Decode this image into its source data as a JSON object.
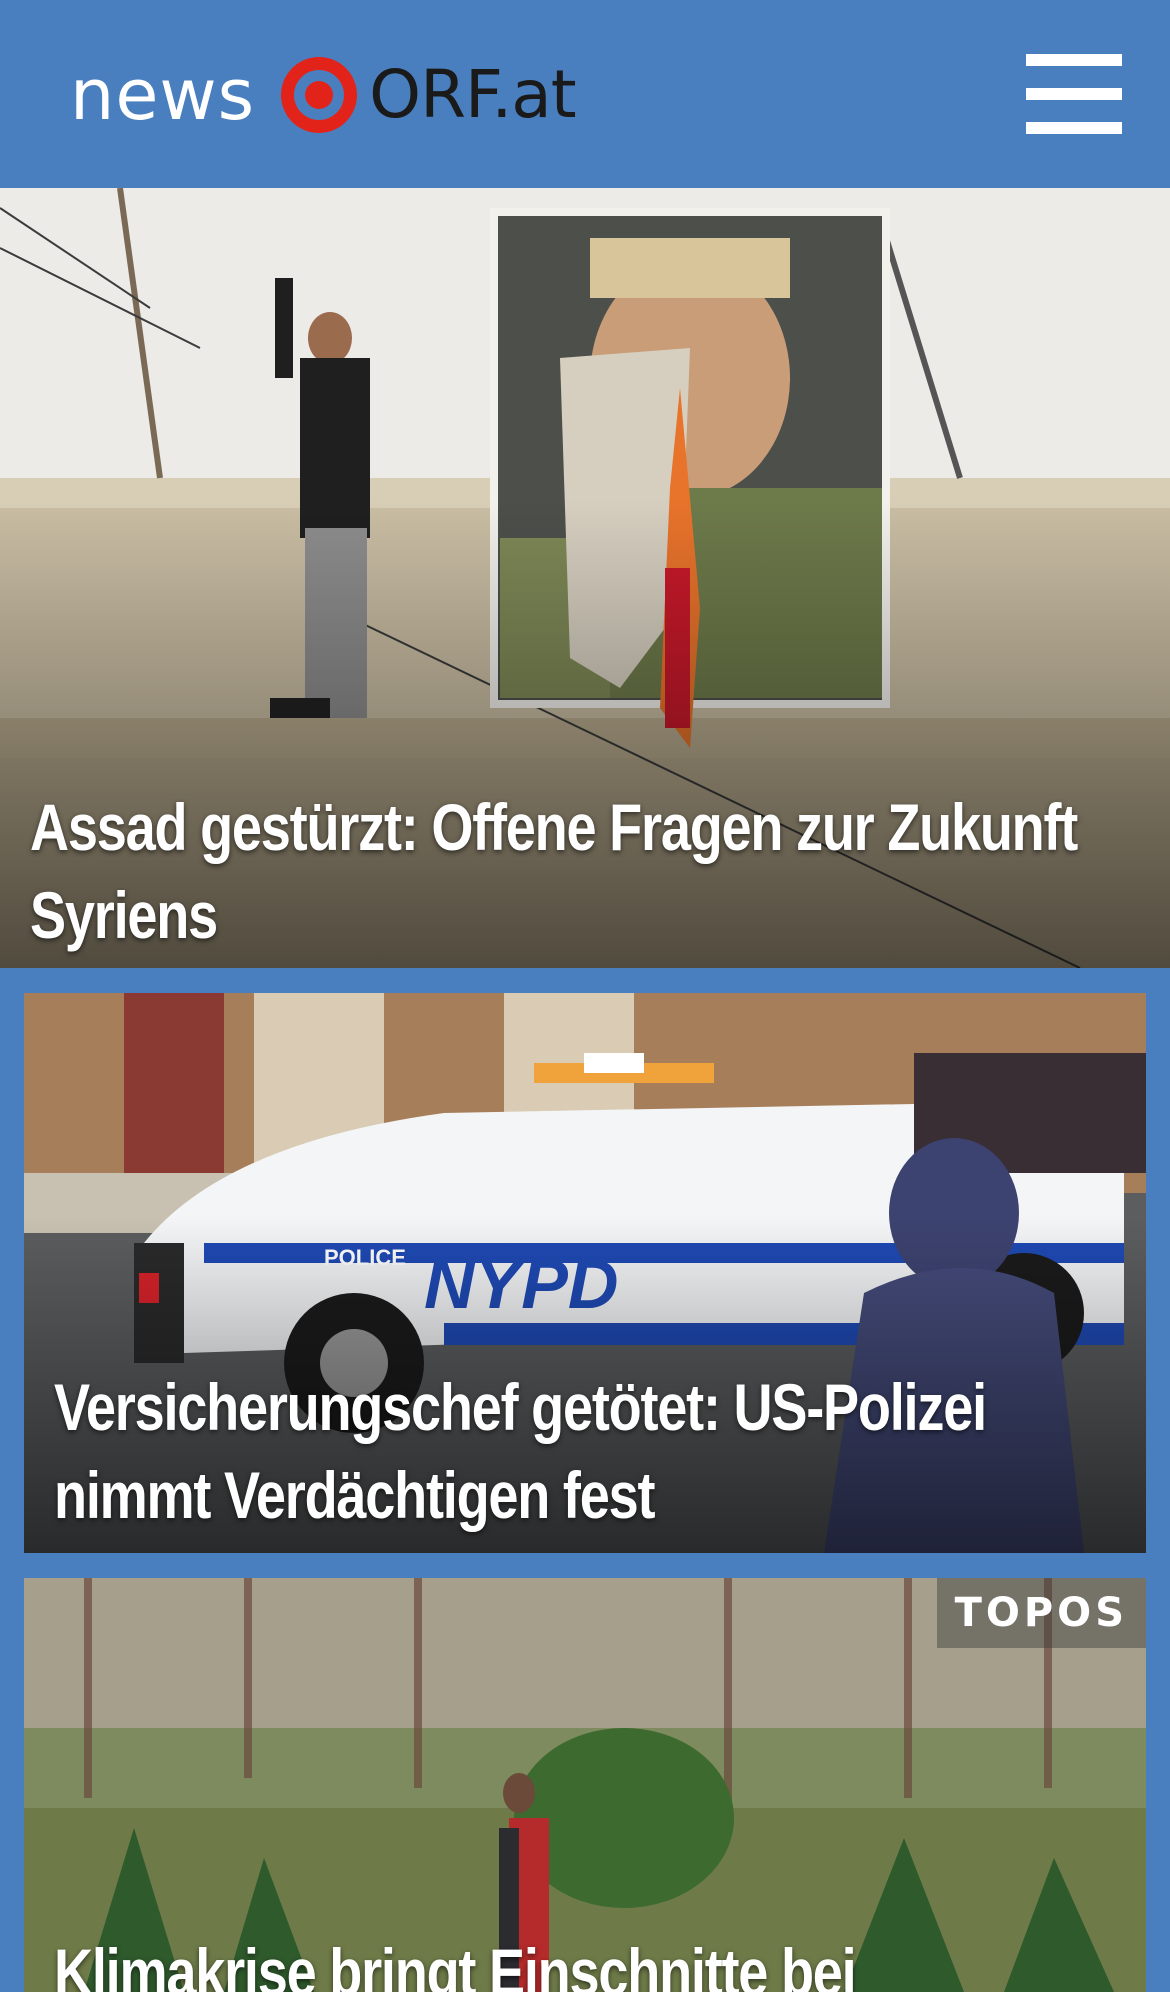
{
  "header": {
    "logo_news": "news",
    "logo_orf": "ORF.at",
    "brand_color": "#4a7fbf",
    "logo_accent": "#e2231a",
    "menu_icon": "hamburger-menu-icon"
  },
  "stories": [
    {
      "headline": "Assad gestürzt: Offene Fragen zur Zukunft Syriens",
      "image": "man on wall beside burning Assad poster"
    },
    {
      "headline": "Versicherungschef getötet: US-Polizei nimmt Verdächtigen fest",
      "image": "NYPD police car with person in hoodie taking photo"
    },
    {
      "headline": "Klimakrise bringt Einschnitte bei",
      "badge": "TOPOS",
      "image": "person carrying a Christmas tree in a forest"
    }
  ]
}
